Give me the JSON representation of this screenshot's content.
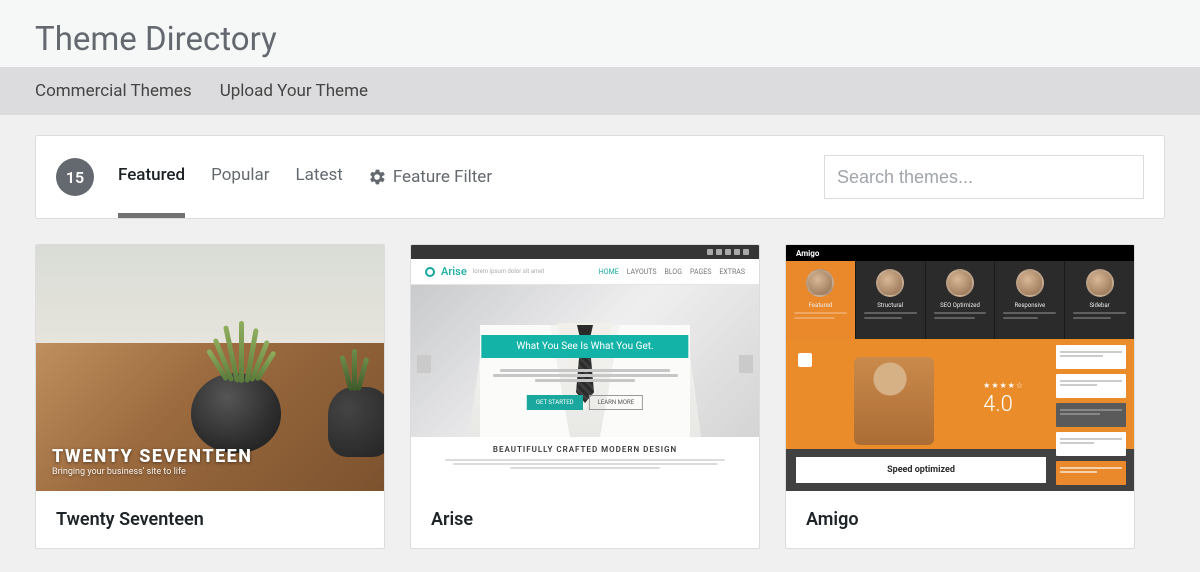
{
  "header": {
    "title": "Theme Directory"
  },
  "subnav": {
    "commercial": "Commercial Themes",
    "upload": "Upload Your Theme"
  },
  "filter": {
    "count": "15",
    "tabs": {
      "featured": "Featured",
      "popular": "Popular",
      "latest": "Latest"
    },
    "feature_filter": "Feature Filter",
    "search_placeholder": "Search themes..."
  },
  "themes": [
    {
      "name": "Twenty Seventeen",
      "screenshot": {
        "headline": "TWENTY SEVENTEEN",
        "tagline": "Bringing your business' site to life"
      }
    },
    {
      "name": "Arise",
      "screenshot": {
        "brand": "Arise",
        "nav_items": [
          "HOME",
          "LAYOUTS",
          "BLOG",
          "PAGES",
          "EXTRAS"
        ],
        "hero_banner": "What You See Is What You Get.",
        "cta_primary": "GET STARTED",
        "cta_secondary": "LEARN MORE",
        "bottom_heading": "BEAUTIFULLY CRAFTED MODERN DESIGN"
      }
    },
    {
      "name": "Amigo",
      "screenshot": {
        "brand": "Amigo",
        "rating_score": "4.0",
        "stars": "★★★★☆",
        "bottom_card": "Speed optimized"
      }
    }
  ]
}
